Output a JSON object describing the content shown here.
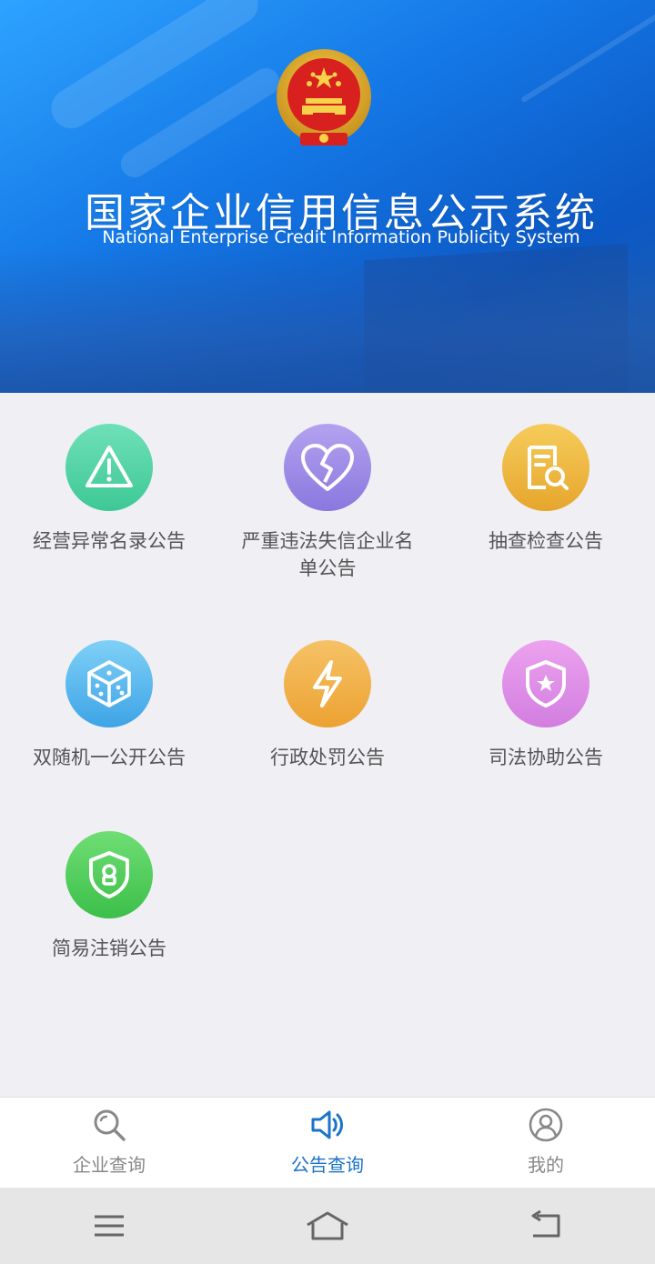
{
  "header": {
    "title_cn": "国家企业信用信息公示系统",
    "title_en": "National Enterprise Credit Information Publicity System"
  },
  "grid": {
    "items": [
      {
        "label": "经营异常名录公告",
        "icon": "warning-icon",
        "color": "#4fd3a6"
      },
      {
        "label": "严重违法失信企业名单公告",
        "icon": "broken-heart-icon",
        "color": "#9b8be6"
      },
      {
        "label": "抽查检查公告",
        "icon": "document-search-icon",
        "color": "#f0b840"
      },
      {
        "label": "双随机一公开公告",
        "icon": "dice-icon",
        "color": "#5ab8ee"
      },
      {
        "label": "行政处罚公告",
        "icon": "lightning-icon",
        "color": "#f4b040"
      },
      {
        "label": "司法协助公告",
        "icon": "shield-star-icon",
        "color": "#e08fe6"
      },
      {
        "label": "简易注销公告",
        "icon": "shield-lock-icon",
        "color": "#48c956"
      }
    ]
  },
  "tabbar": {
    "tabs": [
      {
        "label": "企业查询",
        "icon": "search-icon",
        "active": false
      },
      {
        "label": "公告查询",
        "icon": "speaker-icon",
        "active": true
      },
      {
        "label": "我的",
        "icon": "user-icon",
        "active": false
      }
    ],
    "active_color": "#1a73c8",
    "inactive_color": "#888888"
  },
  "sysnav": {
    "buttons": [
      "menu-icon",
      "home-icon",
      "back-icon"
    ]
  }
}
